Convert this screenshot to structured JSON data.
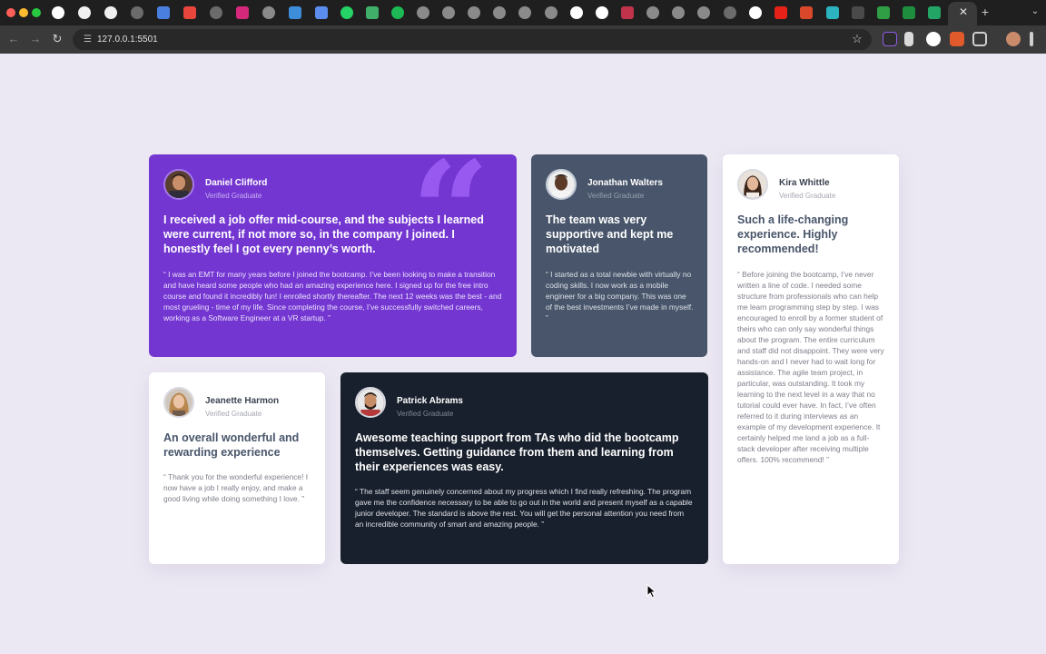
{
  "browser": {
    "url": "127.0.0.1:5501",
    "close_tab_glyph": "✕",
    "new_tab_glyph": "+",
    "tab_menu_glyph": "⌄",
    "back_glyph": "←",
    "forward_glyph": "→",
    "reload_glyph": "↻",
    "site_info_glyph": "☰",
    "bookmark_glyph": "☆"
  },
  "testimonials": [
    {
      "name": "Daniel Clifford",
      "role": "Verified Graduate",
      "headline": "I received a job offer mid-course, and the subjects I learned were current, if not more so, in the company I joined. I honestly feel I got every penny’s worth.",
      "body": "“ I was an EMT for many years before I joined the bootcamp. I’ve been looking to make a transition and have heard some people who had an amazing experience here. I signed up for the free intro course and found it incredibly fun! I enrolled shortly thereafter. The next 12 weeks was the best - and most grueling - time of my life. Since completing the course, I’ve successfully switched careers, working as a Software Engineer at a VR startup. ”",
      "accent": "#7336D1"
    },
    {
      "name": "Jonathan Walters",
      "role": "Verified Graduate",
      "headline": "The team was very supportive and kept me motivated",
      "body": "“ I started as a total newbie with virtually no coding skills. I now work as a mobile engineer for a big company. This was one of the best investments I’ve made in myself. ”",
      "accent": "#48556A"
    },
    {
      "name": "Kira Whittle",
      "role": "Verified Graduate",
      "headline": "Such a life-changing experience. Highly recommended!",
      "body": "“ Before joining the bootcamp, I’ve never written a line of code. I needed some structure from professionals who can help me learn programming step by step. I was encouraged to enroll by a former student of theirs who can only say wonderful things about the program. The entire curriculum and staff did not disappoint. They were very hands-on and I never had to wait long for assistance. The agile team project, in particular, was outstanding. It took my learning to the next level in a way that no tutorial could ever have. In fact, I’ve often referred to it during interviews as an example of my development experience. It certainly helped me land a job as a full-stack developer after receiving multiple offers. 100% recommend! ”",
      "accent": "#FFFFFF"
    },
    {
      "name": "Jeanette Harmon",
      "role": "Verified Graduate",
      "headline": "An overall wonderful and rewarding experience",
      "body": "“ Thank you for the wonderful experience! I now have a job I really enjoy, and make a good living while doing something I love. ”",
      "accent": "#FFFFFF"
    },
    {
      "name": "Patrick Abrams",
      "role": "Verified Graduate",
      "headline": "Awesome teaching support from TAs who did the bootcamp themselves. Getting guidance from them and learning from their experiences was easy.",
      "body": "“ The staff seem genuinely concerned about my progress which I find really refreshing. The program gave me the confidence necessary to be able to go out in the world and present myself as a capable junior developer. The standard is above the rest. You will get the personal attention you need from an incredible community of smart and amazing people. ”",
      "accent": "#19202D"
    }
  ],
  "decoration": {
    "quote_glyph": "“"
  }
}
